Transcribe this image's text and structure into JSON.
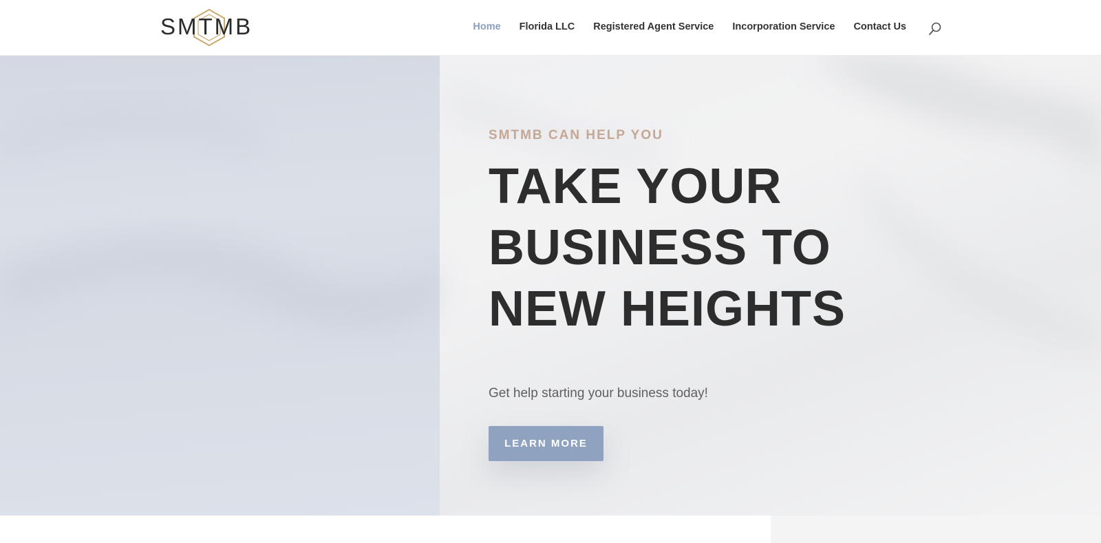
{
  "brand": {
    "logo_text": "SMTMB",
    "logo_icon": "hexagon-monogram-icon",
    "gold": "#c9a96e",
    "dark": "#2a2a2a"
  },
  "nav": {
    "items": [
      {
        "label": "Home",
        "active": true
      },
      {
        "label": "Florida LLC",
        "active": false
      },
      {
        "label": "Registered Agent Service",
        "active": false
      },
      {
        "label": "Incorporation Service",
        "active": false
      },
      {
        "label": "Contact Us",
        "active": false
      }
    ],
    "search_icon": "search-icon",
    "active_color": "#8a9ec0"
  },
  "hero": {
    "eyebrow": "SMTMB CAN HELP YOU",
    "headline_lines": [
      "TAKE YOUR",
      "BUSINESS TO",
      "NEW HEIGHTS"
    ],
    "subtext": "Get help starting your business today!",
    "cta_label": "LEARN MORE",
    "cta_color": "#8fa2c0",
    "eyebrow_color": "#c4a795"
  }
}
